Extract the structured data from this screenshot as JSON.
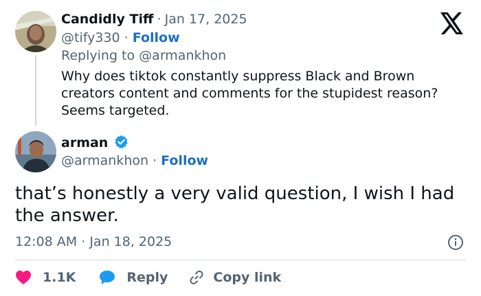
{
  "reply_tweet": {
    "author_name": "Candidly Tiff",
    "date_separator": "·",
    "date": "Jan 17, 2025",
    "handle": "@tify330",
    "follow_separator": "·",
    "follow_label": "Follow",
    "replying_to_prefix": "Replying to",
    "replying_to_handle": "@armankhon",
    "text": "Why does tiktok constantly suppress Black and Brown creators content and comments for the stupidest reason? Seems targeted."
  },
  "main_tweet": {
    "author_name": "arman",
    "verified": true,
    "handle": "@armankhon",
    "follow_separator": "·",
    "follow_label": "Follow",
    "text": "that’s honestly a very valid question, I wish I had the answer.",
    "time": "12:08 AM",
    "time_separator": "·",
    "date": "Jan 18, 2025"
  },
  "actions": {
    "like_count": "1.1K",
    "reply_label": "Reply",
    "copy_link_label": "Copy link"
  },
  "colors": {
    "text": "#0f1419",
    "muted": "#536471",
    "follow": "#1d6fc4",
    "like": "#f91880",
    "reply_bubble": "#1d9bf0",
    "verified": "#1d9bf0",
    "divider": "#cfd9de"
  },
  "icons": {
    "brand": "x-logo-icon",
    "verified": "verified-badge-icon",
    "info": "info-icon",
    "like": "heart-icon",
    "reply": "speech-bubble-icon",
    "copy_link": "link-icon"
  }
}
